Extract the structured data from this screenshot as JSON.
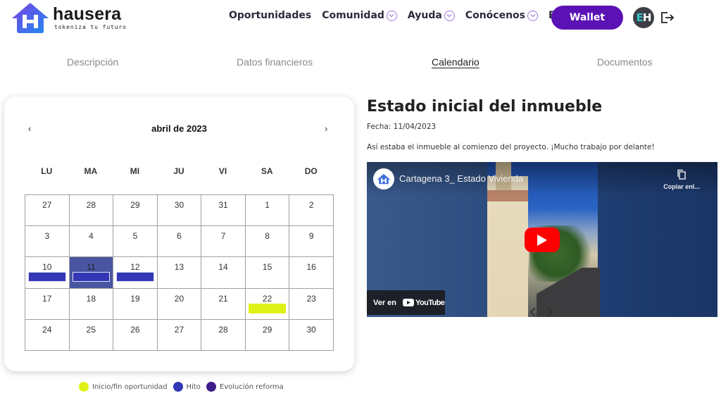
{
  "header": {
    "brand_name": "hausera",
    "brand_tagline": "tokeniza tu futuro",
    "nav": [
      {
        "label": "Oportunidades",
        "has_dropdown": false
      },
      {
        "label": "Comunidad",
        "has_dropdown": true
      },
      {
        "label": "Ayuda",
        "has_dropdown": true
      },
      {
        "label": "Conócenos",
        "has_dropdown": true
      },
      {
        "label": "Blog",
        "has_dropdown": false
      }
    ],
    "wallet_label": "Wallet",
    "avatar_initials": [
      "E",
      "H"
    ],
    "logout_icon": "logout-icon",
    "accent_color": "#5b12b5"
  },
  "tabs": [
    {
      "label": "Descripción",
      "active": false
    },
    {
      "label": "Datos financieros",
      "active": false
    },
    {
      "label": "Calendario",
      "active": true
    },
    {
      "label": "Documentos",
      "active": false
    }
  ],
  "calendar": {
    "title": "abril de 2023",
    "prev_label": "‹",
    "next_label": "›",
    "weekdays": [
      "LU",
      "MA",
      "MI",
      "JU",
      "VI",
      "SA",
      "DO"
    ],
    "weeks": [
      [
        {
          "day": "27"
        },
        {
          "day": "28"
        },
        {
          "day": "29"
        },
        {
          "day": "30"
        },
        {
          "day": "31"
        },
        {
          "day": "1"
        },
        {
          "day": "2"
        }
      ],
      [
        {
          "day": "3"
        },
        {
          "day": "4"
        },
        {
          "day": "5"
        },
        {
          "day": "6"
        },
        {
          "day": "7"
        },
        {
          "day": "8"
        },
        {
          "day": "9"
        }
      ],
      [
        {
          "day": "10",
          "event": "hito"
        },
        {
          "day": "11",
          "event": "hito",
          "selected": true
        },
        {
          "day": "12",
          "event": "hito"
        },
        {
          "day": "13"
        },
        {
          "day": "14"
        },
        {
          "day": "15"
        },
        {
          "day": "16"
        }
      ],
      [
        {
          "day": "17"
        },
        {
          "day": "18"
        },
        {
          "day": "19"
        },
        {
          "day": "20"
        },
        {
          "day": "21"
        },
        {
          "day": "22",
          "event": "inicio"
        },
        {
          "day": "23"
        }
      ],
      [
        {
          "day": "24"
        },
        {
          "day": "25"
        },
        {
          "day": "26"
        },
        {
          "day": "27"
        },
        {
          "day": "28"
        },
        {
          "day": "29"
        },
        {
          "day": "30"
        }
      ]
    ],
    "selected_color": "#4a55a2"
  },
  "legend": [
    {
      "label": "Inicio/fin oportunidad",
      "color": "#dff218"
    },
    {
      "label": "Hito",
      "color": "#3337b5"
    },
    {
      "label": "Evolución reforma",
      "color": "#3f1d8a"
    }
  ],
  "detail": {
    "title": "Estado inicial del inmueble",
    "date": "Fecha: 11/04/2023",
    "description": "Así estaba el inmueble al comienzo del proyecto. ¡Mucho trabajo por delante!"
  },
  "video": {
    "title": "Cartagena 3_ Estado Vivienda",
    "copy_link_label": "Copiar enl...",
    "watch_on_label": "Ver en",
    "youtube_label": "YouTube"
  }
}
